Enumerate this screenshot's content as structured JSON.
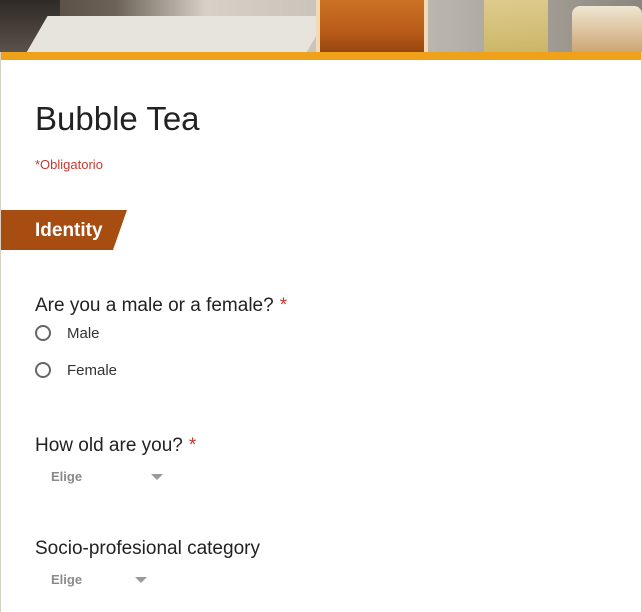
{
  "header": {
    "image_name": "bubble-tea-glasses-header-image"
  },
  "form": {
    "title": "Bubble Tea",
    "required_note": "*Obligatorio",
    "accent_color": "#f0a11a",
    "section_color": "#a84d12"
  },
  "section": {
    "label": "Identity"
  },
  "questions": [
    {
      "label": "Are you a male or a female?",
      "required_mark": "*",
      "options": [
        "Male",
        "Female"
      ]
    },
    {
      "label": "How old are you?",
      "required_mark": "*",
      "select_value": "Elige"
    },
    {
      "label": "Socio-profesional category",
      "select_value": "Elige"
    }
  ]
}
